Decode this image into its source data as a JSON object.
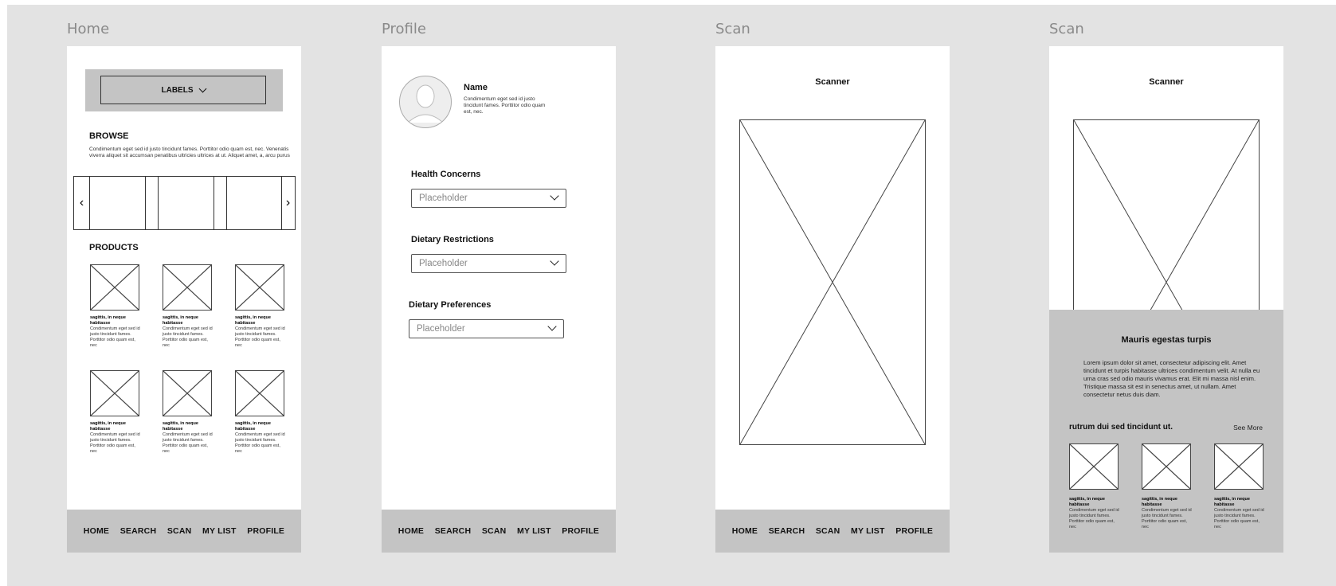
{
  "frames": {
    "home": "Home",
    "profile": "Profile",
    "scan1": "Scan",
    "scan2": "Scan"
  },
  "nav": [
    "HOME",
    "SEARCH",
    "SCAN",
    "MY LIST",
    "PROFILE"
  ],
  "home": {
    "labels_button": "LABELS",
    "browse": {
      "heading": "BROWSE",
      "text": "Condimentum eget sed id justo tincidunt fames. Porttitor odio quam est, nec. Venenatis viverra aliquet sit accumsan penatibus ultricies ultrices at ut. Aliquet amet, a, arcu purus",
      "prev": "‹",
      "next": "›"
    },
    "products": {
      "heading": "PRODUCTS",
      "items": [
        {
          "title": "sagittis, in neque habitasse",
          "text": "Condimentum eget sed id justo tincidunt fames. Porttitor odio quam est, nec"
        },
        {
          "title": "sagittis, in neque habitasse",
          "text": "Condimentum eget sed id justo tincidunt fames. Porttitor odio quam est, nec"
        },
        {
          "title": "sagittis, in neque habitasse",
          "text": "Condimentum eget sed id justo tincidunt fames. Porttitor odio quam est, nec"
        },
        {
          "title": "sagittis, in neque habitasse",
          "text": "Condimentum eget sed id justo tincidunt fames. Porttitor odio quam est, nec"
        },
        {
          "title": "sagittis, in neque habitasse",
          "text": "Condimentum eget sed id justo tincidunt fames. Porttitor odio quam est, nec"
        },
        {
          "title": "sagittis, in neque habitasse",
          "text": "Condimentum eget sed id justo tincidunt fames. Porttitor odio quam est, nec"
        }
      ]
    }
  },
  "profile": {
    "name": "Name",
    "bio": "Condimentum eget sed id justo tincidunt fames. Porttitor odio quam est, nec.",
    "fields": [
      {
        "label": "Health Concerns",
        "placeholder": "Placeholder"
      },
      {
        "label": "Dietary Restrictions",
        "placeholder": "Placeholder"
      },
      {
        "label": "Dietary Preferences",
        "placeholder": "Placeholder"
      }
    ]
  },
  "scan1": {
    "title": "Scanner"
  },
  "scan2": {
    "title": "Scanner",
    "sheet_title": "Mauris egestas turpis",
    "sheet_text": "Lorem ipsum dolor sit amet, consectetur adipiscing elit. Amet tincidunt et turpis habitasse ultrices condimentum velit. At nulla eu urna cras sed odio mauris vivamus erat. Elit mi massa nisl enim. Tristique massa sit est in senectus amet, ut nullam. Amet consectetur netus duis diam.",
    "related_heading": "rutrum dui sed tincidunt ut.",
    "see_more": "See More",
    "items": [
      {
        "title": "sagittis, in neque habitasse",
        "text": "Condimentum eget sed id justo tincidunt fames. Porttitor odio quam est, nec"
      },
      {
        "title": "sagittis, in neque habitasse",
        "text": "Condimentum eget sed id justo tincidunt fames. Porttitor odio quam est, nec"
      },
      {
        "title": "sagittis, in neque habitasse",
        "text": "Condimentum eget sed id justo tincidunt fames. Porttitor odio quam est, nec"
      }
    ]
  },
  "colors": {
    "canvas": "#e3e3e3",
    "navbar": "#c4c4c4",
    "sheet": "#c4c4c4",
    "screen": "#ffffff"
  }
}
